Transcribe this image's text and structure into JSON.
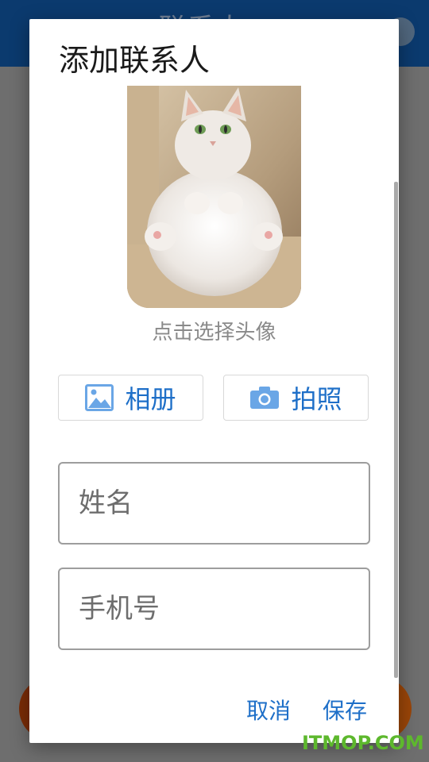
{
  "background": {
    "app_title": "联系人"
  },
  "dialog": {
    "title": "添加联系人",
    "avatar_caption": "点击选择头像",
    "album_label": "相册",
    "camera_label": "拍照",
    "name_placeholder": "姓名",
    "phone_placeholder": "手机号",
    "cancel_label": "取消",
    "save_label": "保存"
  },
  "watermark": "ITMOP.COM",
  "colors": {
    "accent": "#1e6fc8",
    "icon": "#6aa6e6",
    "app_bar": "#0b3a6e"
  },
  "icons": {
    "album": "image-icon",
    "camera": "camera-icon",
    "settings": "gear-icon"
  }
}
